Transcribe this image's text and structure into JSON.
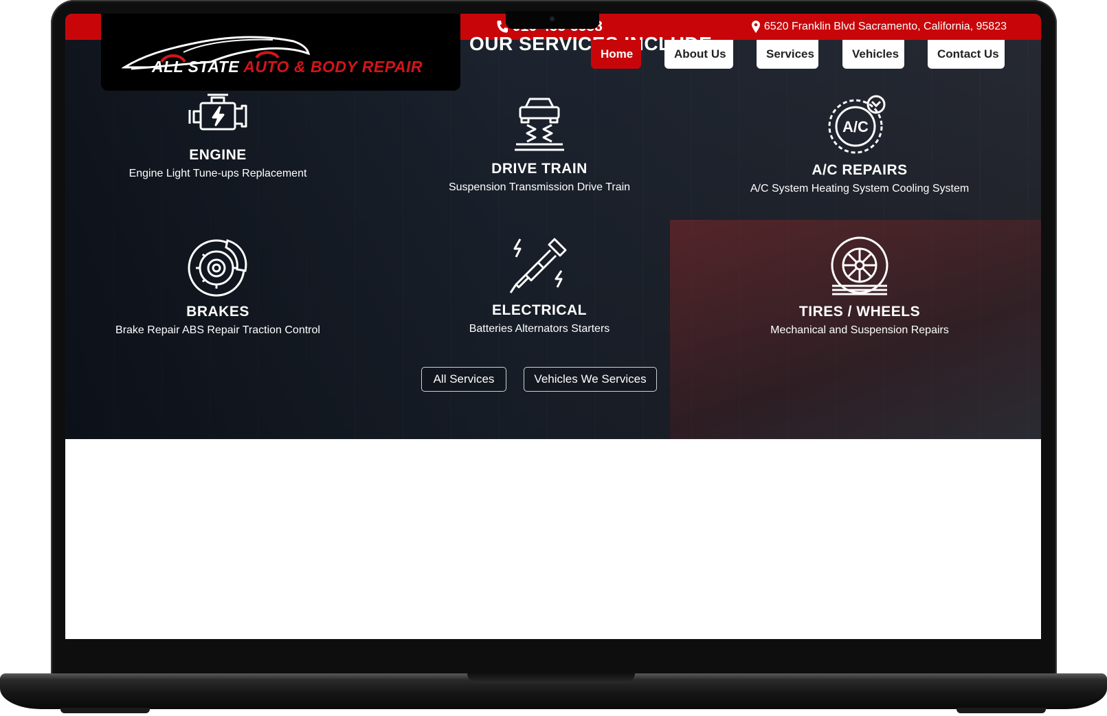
{
  "topbar": {
    "phone": "916-455-5588",
    "address": "6520 Franklin Blvd Sacramento, California, 95823"
  },
  "logo": {
    "part1": "ALL STATE ",
    "part2": "AUTO & BODY REPAIR"
  },
  "section_heading": "OUR SERVICES INCLUDE",
  "nav": [
    {
      "label": "Home",
      "active": true
    },
    {
      "label": "About Us"
    },
    {
      "label": "Services"
    },
    {
      "label": "Vehicles"
    },
    {
      "label": "Contact Us"
    }
  ],
  "services": [
    {
      "title": "ENGINE",
      "desc": "Engine Light Tune-ups Replacement",
      "icon": "engine-icon"
    },
    {
      "title": "DRIVE TRAIN",
      "desc": "Suspension Transmission Drive Train",
      "icon": "car-lift-icon"
    },
    {
      "title": "A/C REPAIRS",
      "desc": "A/C System Heating System Cooling System",
      "icon": "ac-wrench-icon",
      "icon_text": "A/C"
    },
    {
      "title": "BRAKES",
      "desc": "Brake Repair ABS Repair Traction Control",
      "icon": "brake-disc-icon"
    },
    {
      "title": "ELECTRICAL",
      "desc": "Batteries Alternators Starters",
      "icon": "spark-plug-icon"
    },
    {
      "title": "TIRES / WHEELS",
      "desc": "Mechanical and Suspension Repairs",
      "icon": "tire-icon"
    }
  ],
  "buttons": {
    "all_services": "All Services",
    "vehicles": "Vehicles We Services"
  },
  "colors": {
    "accent": "#c8060a",
    "dark": "#000000"
  }
}
